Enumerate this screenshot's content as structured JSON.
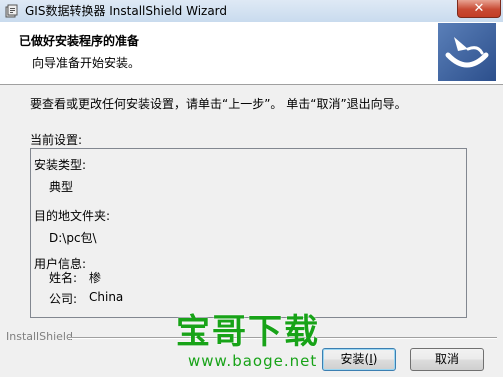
{
  "window": {
    "title": "GIS数据转换器 InstallShield Wizard",
    "close_label": "✕"
  },
  "banner": {
    "title": "已做好安装程序的准备",
    "subtitle": "向导准备开始安装。"
  },
  "instruction": "要查看或更改任何安装设置，请单击“上一步”。 单击“取消”退出向导。",
  "settings": {
    "label": "当前设置:",
    "setup_type_label": "安装类型:",
    "setup_type_value": "典型",
    "dest_folder_label": "目的地文件夹:",
    "dest_folder_value": "D:\\pc包\\",
    "user_info_label": "用户信息:",
    "name_label": "姓名:",
    "name_value": "椮",
    "company_label": "公司:",
    "company_value": "China"
  },
  "footer": {
    "brand": "InstallShield",
    "install_label": "安装(",
    "install_hotkey": "I",
    "install_suffix": ")",
    "cancel_label": "取消"
  },
  "watermark": {
    "text": "宝哥下载",
    "url": "www.baoge.net"
  },
  "colors": {
    "watermark": "#18a318",
    "close_button": "#c84a33"
  }
}
